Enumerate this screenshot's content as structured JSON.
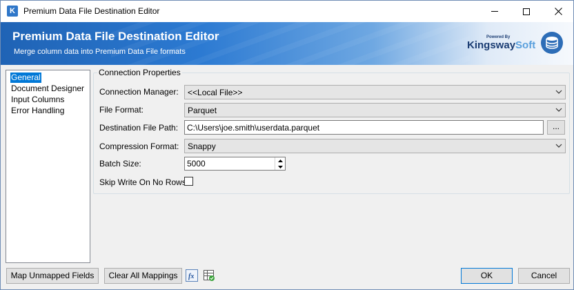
{
  "window": {
    "title": "Premium Data File Destination Editor",
    "app_icon_letter": "K"
  },
  "banner": {
    "title": "Premium Data File Destination Editor",
    "subtitle": "Merge column data into Premium Data File formats",
    "brand_powered": "Powered By",
    "brand_k": "K",
    "brand_ingsway": "ingsway",
    "brand_soft": "Soft"
  },
  "nav": {
    "items": [
      {
        "label": "General",
        "selected": true
      },
      {
        "label": "Document Designer",
        "selected": false
      },
      {
        "label": "Input Columns",
        "selected": false
      },
      {
        "label": "Error Handling",
        "selected": false
      }
    ]
  },
  "connection": {
    "legend": "Connection Properties",
    "manager_label": "Connection Manager:",
    "manager_value": "<<Local File>>",
    "format_label": "File Format:",
    "format_value": "Parquet",
    "path_label": "Destination File Path:",
    "path_value": "C:\\Users\\joe.smith\\userdata.parquet",
    "browse_label": "...",
    "compression_label": "Compression Format:",
    "compression_value": "Snappy",
    "batch_label": "Batch Size:",
    "batch_value": "5000",
    "skip_label": "Skip Write On No Rows:",
    "skip_checked": false
  },
  "footer": {
    "map_unmapped": "Map Unmapped Fields",
    "clear_mappings": "Clear All Mappings",
    "fx_icon_text": "fx",
    "ok": "OK",
    "cancel": "Cancel"
  },
  "colors": {
    "selection": "#0078d7",
    "banner_blue": "#1f63b5",
    "brand_dark": "#1b3d73",
    "brand_light": "#5aa0dd"
  }
}
